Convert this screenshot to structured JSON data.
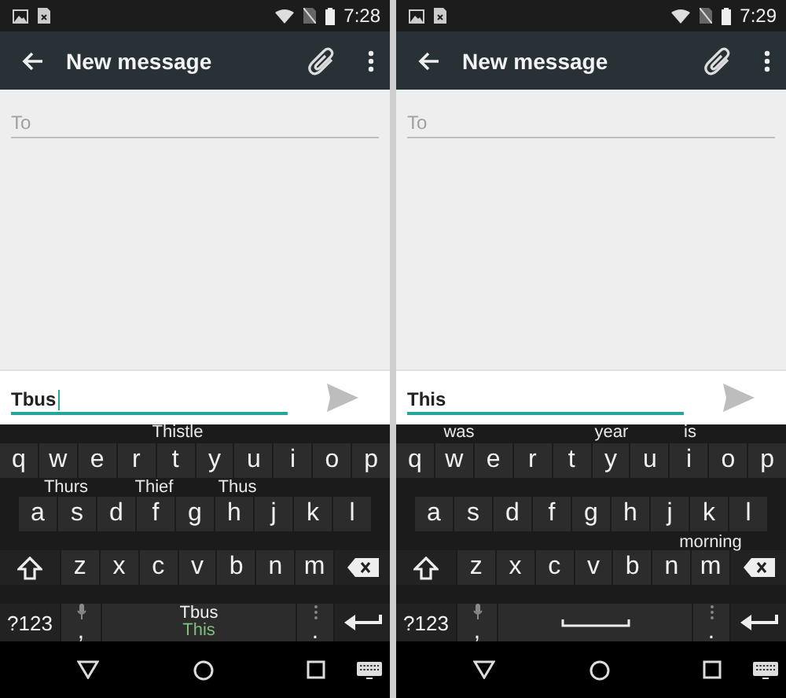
{
  "screens": [
    {
      "status_bar": {
        "time": "7:28"
      },
      "toolbar": {
        "title": "New message"
      },
      "recipient_field": {
        "placeholder": "To"
      },
      "compose_field": {
        "value": "Tbus",
        "cursor": true
      },
      "keyboard": {
        "floating_suggestions": [
          "Thistle",
          "Thurs",
          "Thief",
          "Thus"
        ],
        "rows": [
          {
            "keys": [
              {
                "kind": "letter",
                "label": "q"
              },
              {
                "kind": "letter",
                "label": "w"
              },
              {
                "kind": "letter",
                "label": "e"
              },
              {
                "kind": "letter",
                "label": "r"
              },
              {
                "kind": "letter",
                "label": "t"
              },
              {
                "kind": "letter",
                "label": "y"
              },
              {
                "kind": "letter",
                "label": "u"
              },
              {
                "kind": "letter",
                "label": "i"
              },
              {
                "kind": "letter",
                "label": "o"
              },
              {
                "kind": "letter",
                "label": "p"
              }
            ]
          },
          {
            "keys": [
              {
                "kind": "letter",
                "label": "a"
              },
              {
                "kind": "letter",
                "label": "s"
              },
              {
                "kind": "letter",
                "label": "d"
              },
              {
                "kind": "letter",
                "label": "f"
              },
              {
                "kind": "letter",
                "label": "g"
              },
              {
                "kind": "letter",
                "label": "h"
              },
              {
                "kind": "letter",
                "label": "j"
              },
              {
                "kind": "letter",
                "label": "k"
              },
              {
                "kind": "letter",
                "label": "l"
              }
            ]
          },
          {
            "keys": [
              {
                "kind": "shift"
              },
              {
                "kind": "letter",
                "label": "z"
              },
              {
                "kind": "letter",
                "label": "x"
              },
              {
                "kind": "letter",
                "label": "c"
              },
              {
                "kind": "letter",
                "label": "v"
              },
              {
                "kind": "letter",
                "label": "b"
              },
              {
                "kind": "letter",
                "label": "n"
              },
              {
                "kind": "letter",
                "label": "m"
              },
              {
                "kind": "backspace"
              }
            ]
          },
          {
            "keys": [
              {
                "kind": "symbols",
                "label": "?123"
              },
              {
                "kind": "comma",
                "label": ","
              },
              {
                "kind": "space",
                "suggestions": [
                  {
                    "text": "Tbus",
                    "selected": false
                  },
                  {
                    "text": "This",
                    "selected": true
                  }
                ]
              },
              {
                "kind": "period",
                "label": "."
              },
              {
                "kind": "enter"
              }
            ]
          }
        ]
      }
    },
    {
      "status_bar": {
        "time": "7:29"
      },
      "toolbar": {
        "title": "New message"
      },
      "recipient_field": {
        "placeholder": "To"
      },
      "compose_field": {
        "value": "This",
        "cursor": false
      },
      "keyboard": {
        "floating_suggestions": [
          "was",
          "year",
          "is",
          "morning"
        ],
        "rows": [
          {
            "keys": [
              {
                "kind": "letter",
                "label": "q"
              },
              {
                "kind": "letter",
                "label": "w"
              },
              {
                "kind": "letter",
                "label": "e"
              },
              {
                "kind": "letter",
                "label": "r"
              },
              {
                "kind": "letter",
                "label": "t"
              },
              {
                "kind": "letter",
                "label": "y"
              },
              {
                "kind": "letter",
                "label": "u"
              },
              {
                "kind": "letter",
                "label": "i"
              },
              {
                "kind": "letter",
                "label": "o"
              },
              {
                "kind": "letter",
                "label": "p"
              }
            ]
          },
          {
            "keys": [
              {
                "kind": "letter",
                "label": "a"
              },
              {
                "kind": "letter",
                "label": "s"
              },
              {
                "kind": "letter",
                "label": "d"
              },
              {
                "kind": "letter",
                "label": "f"
              },
              {
                "kind": "letter",
                "label": "g"
              },
              {
                "kind": "letter",
                "label": "h"
              },
              {
                "kind": "letter",
                "label": "j"
              },
              {
                "kind": "letter",
                "label": "k"
              },
              {
                "kind": "letter",
                "label": "l"
              }
            ]
          },
          {
            "keys": [
              {
                "kind": "shift"
              },
              {
                "kind": "letter",
                "label": "z"
              },
              {
                "kind": "letter",
                "label": "x"
              },
              {
                "kind": "letter",
                "label": "c"
              },
              {
                "kind": "letter",
                "label": "v"
              },
              {
                "kind": "letter",
                "label": "b"
              },
              {
                "kind": "letter",
                "label": "n"
              },
              {
                "kind": "letter",
                "label": "m"
              },
              {
                "kind": "backspace"
              }
            ]
          },
          {
            "keys": [
              {
                "kind": "symbols",
                "label": "?123"
              },
              {
                "kind": "comma",
                "label": ","
              },
              {
                "kind": "space"
              },
              {
                "kind": "period",
                "label": "."
              },
              {
                "kind": "enter"
              }
            ]
          }
        ]
      }
    }
  ]
}
